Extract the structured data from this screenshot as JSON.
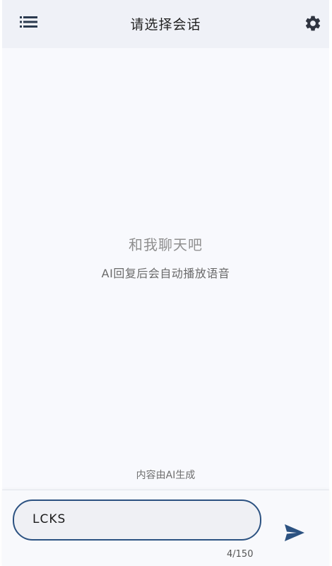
{
  "header": {
    "title": "请选择会话",
    "menu_icon": "list-menu-icon",
    "settings_icon": "gear-icon"
  },
  "empty_state": {
    "title": "和我聊天吧",
    "subtitle": "AI回复后会自动播放语音"
  },
  "disclaimer": "内容由AI生成",
  "composer": {
    "input_value": "LCKS",
    "char_count": "4/150",
    "send_icon": "send-icon"
  },
  "colors": {
    "accent": "#2c5281",
    "header_bg": "#eff1f7",
    "page_bg": "#f8f9fd"
  }
}
